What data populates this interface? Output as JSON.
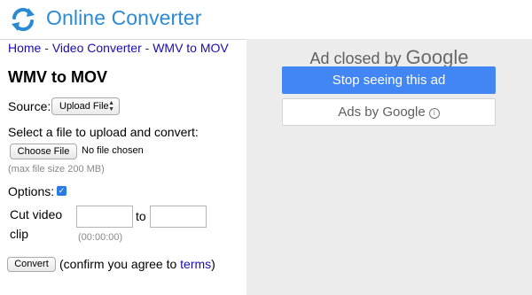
{
  "header": {
    "site_title": "Online Converter"
  },
  "breadcrumb": {
    "home": "Home",
    "sep1": " - ",
    "video_converter": "Video Converter",
    "sep2": " - ",
    "current": "WMV to MOV"
  },
  "page_title": "WMV to MOV",
  "source": {
    "label": "Source:",
    "selected": "Upload File"
  },
  "upload": {
    "prompt": "Select a file to upload and convert:",
    "choose_button": "Choose File",
    "no_file_text": "No file chosen",
    "max_size_note": "(max file size 200 MB)"
  },
  "options": {
    "label": "Options:",
    "checked": true
  },
  "cut": {
    "label_line1": "Cut video",
    "label_line2": "clip",
    "to": "to",
    "format_hint": "(00:00:00)"
  },
  "convert": {
    "button": "Convert",
    "confirm_prefix": "(confirm you agree to ",
    "terms": "terms",
    "confirm_suffix": ")"
  },
  "ad": {
    "closed_text": "Ad closed by",
    "google": "Google",
    "stop_button": "Stop seeing this ad",
    "ads_by_text": "Ads by Google",
    "info_glyph": "i"
  },
  "colors": {
    "brand": "#2a8ad4",
    "link": "#1a0dab",
    "ad_button": "#4285f4"
  }
}
